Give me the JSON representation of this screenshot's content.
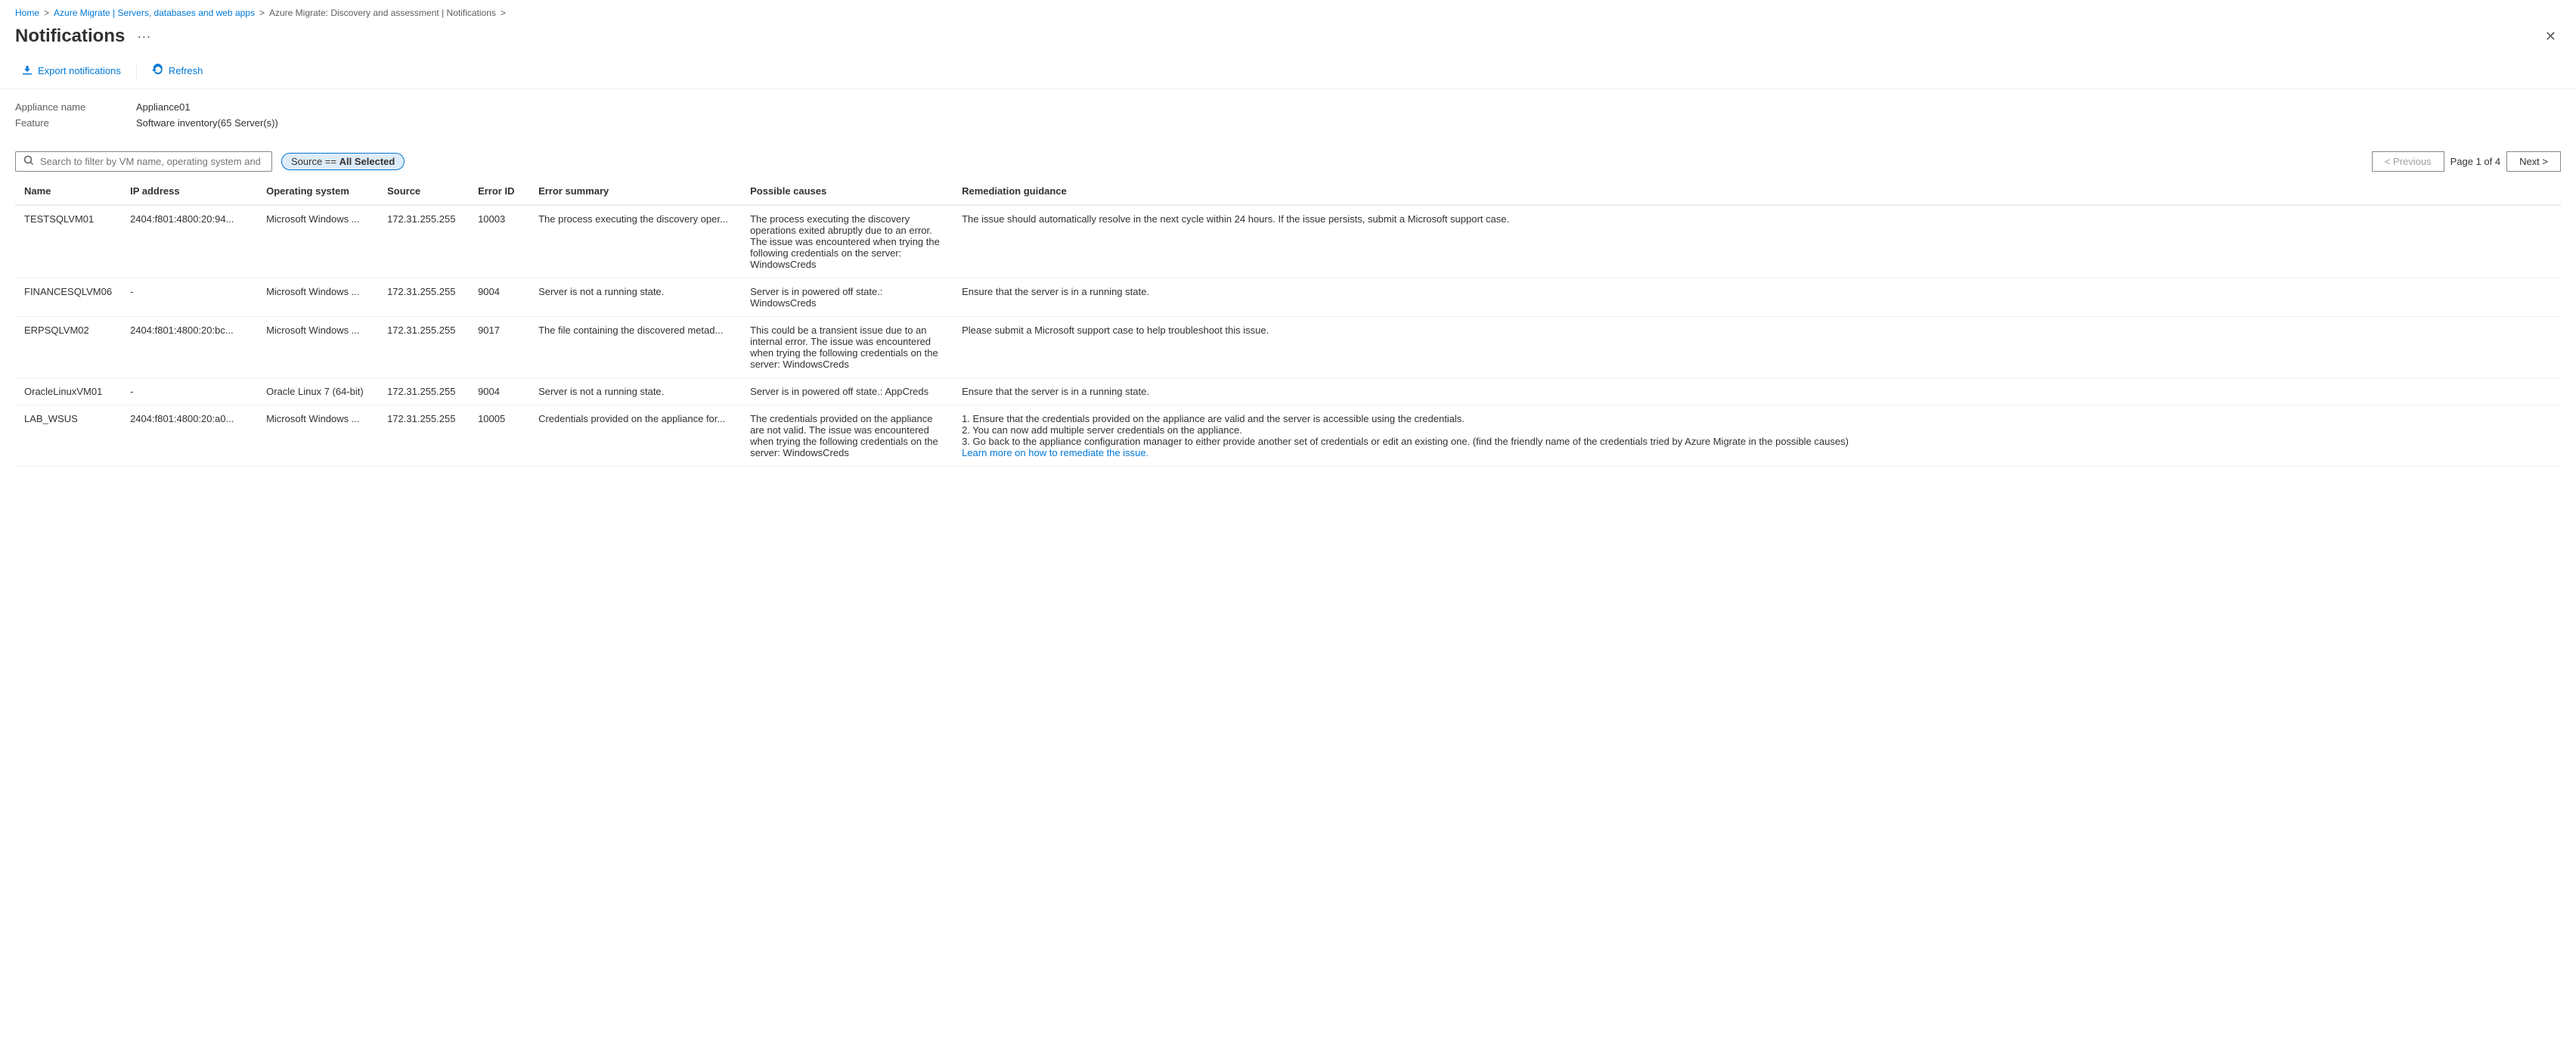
{
  "breadcrumb": {
    "items": [
      {
        "label": "Home",
        "link": true
      },
      {
        "label": "Azure Migrate | Servers, databases and web apps",
        "link": true
      },
      {
        "label": "Azure Migrate: Discovery and assessment | Notifications",
        "link": true
      }
    ],
    "separator": ">"
  },
  "header": {
    "title": "Notifications",
    "more_label": "···",
    "close_label": "✕"
  },
  "toolbar": {
    "export_label": "Export notifications",
    "refresh_label": "Refresh"
  },
  "meta": {
    "appliance_name_label": "Appliance name",
    "appliance_name_value": "Appliance01",
    "feature_label": "Feature",
    "feature_value": "Software inventory(65 Server(s))"
  },
  "search": {
    "placeholder": "Search to filter by VM name, operating system and error ID"
  },
  "source_filter": {
    "prefix": "Source ==",
    "value": "All Selected"
  },
  "pagination": {
    "previous_label": "< Previous",
    "next_label": "Next >",
    "page_info": "Page 1 of 4"
  },
  "table": {
    "columns": [
      "Name",
      "IP address",
      "Operating system",
      "Source",
      "Error ID",
      "Error summary",
      "Possible causes",
      "Remediation guidance"
    ],
    "rows": [
      {
        "name": "TESTSQLVM01",
        "ip": "2404:f801:4800:20:94...",
        "os": "Microsoft Windows ...",
        "source": "172.31.255.255",
        "errorId": "10003",
        "errorSummary": "The process executing the discovery oper...",
        "causes": "The process executing the discovery operations exited abruptly due to an error. The issue was encountered when trying the following credentials on the server: WindowsCreds",
        "remediation": "The issue should automatically resolve in the next cycle within 24 hours. If the issue persists, submit a Microsoft support case."
      },
      {
        "name": "FINANCESQLVM06",
        "ip": "-",
        "os": "Microsoft Windows ...",
        "source": "172.31.255.255",
        "errorId": "9004",
        "errorSummary": "Server is not a running state.",
        "causes": "Server is in powered off state.: WindowsCreds",
        "remediation": "Ensure that the server is in a running state."
      },
      {
        "name": "ERPSQLVM02",
        "ip": "2404:f801:4800:20:bc...",
        "os": "Microsoft Windows ...",
        "source": "172.31.255.255",
        "errorId": "9017",
        "errorSummary": "The file containing the discovered metad...",
        "causes": "This could be a transient issue due to an internal error. The issue was encountered when trying the following credentials on the server: WindowsCreds",
        "remediation": "Please submit a Microsoft support case to help troubleshoot this issue."
      },
      {
        "name": "OracleLinuxVM01",
        "ip": "-",
        "os": "Oracle Linux 7 (64-bit)",
        "source": "172.31.255.255",
        "errorId": "9004",
        "errorSummary": "Server is not a running state.",
        "causes": "Server is in powered off state.: AppCreds",
        "remediation": "Ensure that the server is in a running state."
      },
      {
        "name": "LAB_WSUS",
        "ip": "2404:f801:4800:20:a0...",
        "os": "Microsoft Windows ...",
        "source": "172.31.255.255",
        "errorId": "10005",
        "errorSummary": "Credentials provided on the appliance for...",
        "causes": "The credentials provided on the appliance are not valid. The issue was encountered when trying the following credentials on the server: WindowsCreds",
        "remediation": "1. Ensure that the credentials provided on the appliance are valid and the server is accessible using the credentials.\n2. You can now add multiple server credentials on the appliance.\n3. Go back to the appliance configuration manager to either provide another set of credentials or edit an existing one. (find the friendly name of the credentials tried by Azure Migrate in the possible causes)",
        "learnMore": "Learn more on how to remediate the issue."
      }
    ]
  }
}
